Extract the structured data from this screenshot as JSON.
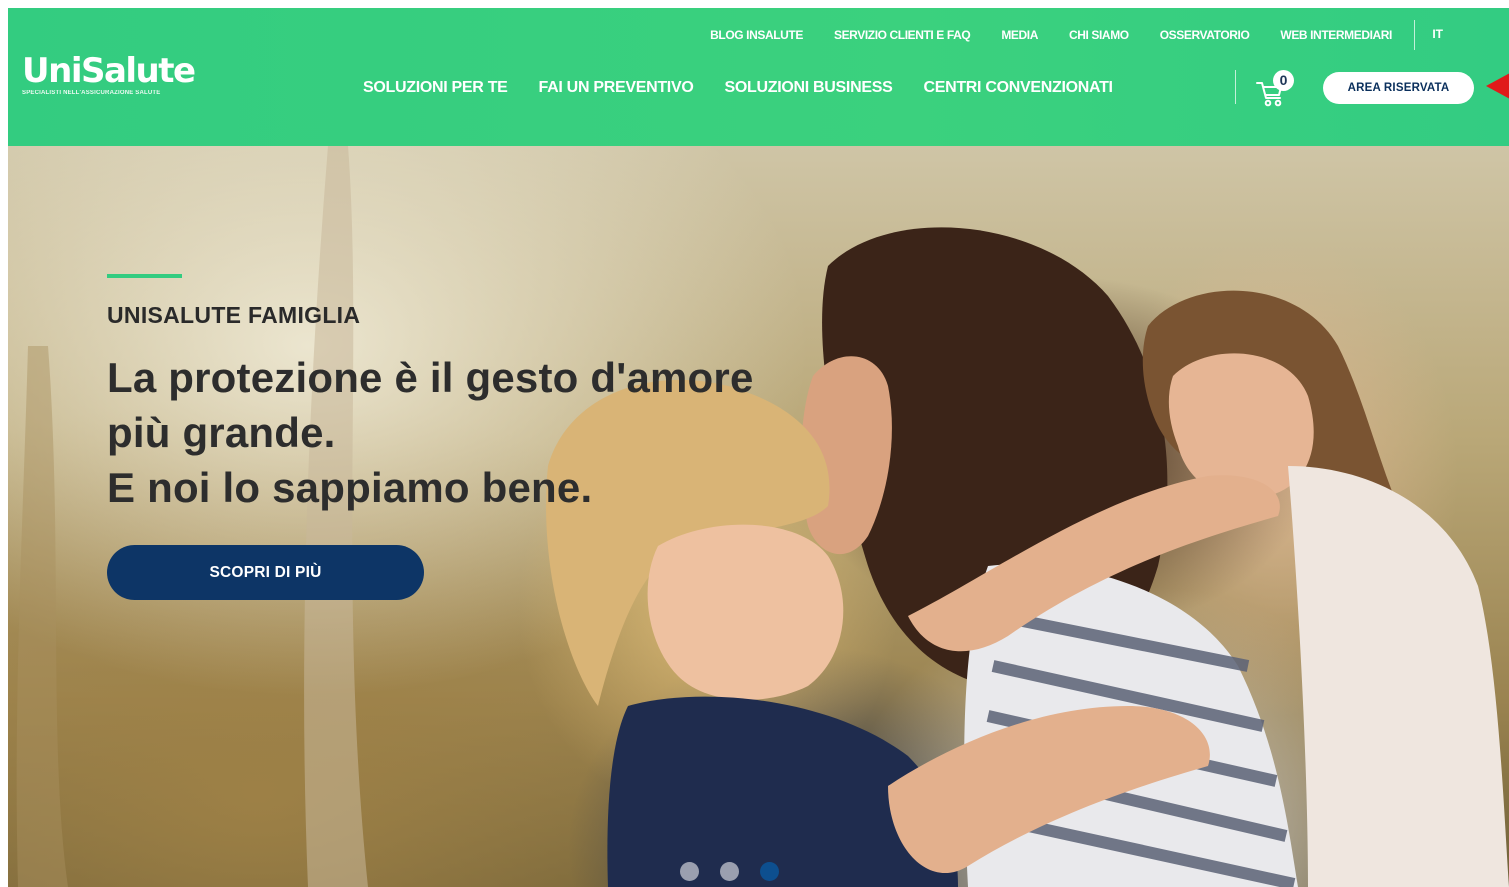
{
  "brand": {
    "name": "UniSalute",
    "tagline": "SPECIALISTI NELL'ASSICURAZIONE SALUTE"
  },
  "top_nav": {
    "items": [
      {
        "label": "BLOG INSALUTE"
      },
      {
        "label": "SERVIZIO CLIENTI E FAQ"
      },
      {
        "label": "MEDIA"
      },
      {
        "label": "CHI SIAMO"
      },
      {
        "label": "OSSERVATORIO"
      },
      {
        "label": "WEB INTERMEDIARI"
      }
    ],
    "language": "IT"
  },
  "main_nav": {
    "items": [
      {
        "label": "SOLUZIONI PER TE"
      },
      {
        "label": "FAI UN PREVENTIVO"
      },
      {
        "label": "SOLUZIONI BUSINESS"
      },
      {
        "label": "CENTRI CONVENZIONATI"
      }
    ]
  },
  "cart": {
    "count": "0",
    "icon": "cart-icon"
  },
  "account": {
    "button_label": "AREA RISERVATA"
  },
  "hero": {
    "eyebrow": "UNISALUTE FAMIGLIA",
    "headline_lines": [
      "La protezione è il gesto d'amore",
      "più grande.",
      "E noi lo sappiamo bene."
    ],
    "cta_label": "SCOPRI DI PIÙ",
    "slides": {
      "total": 3,
      "active_index": 2
    }
  },
  "colors": {
    "header_green": "#33cc80",
    "accent_green": "#33cc80",
    "cta_navy": "#0d3566",
    "annotation_red": "#e01a1a"
  }
}
